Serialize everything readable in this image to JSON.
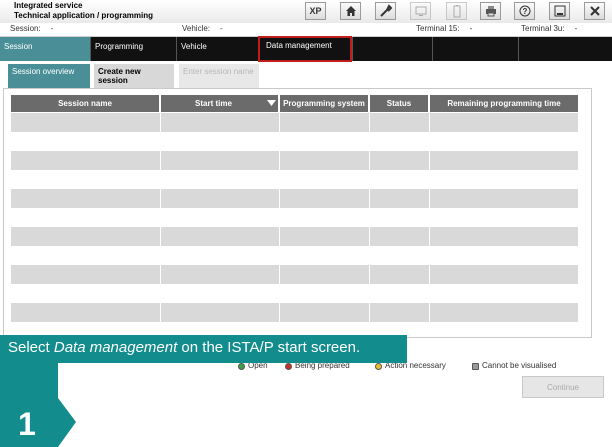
{
  "app": {
    "title_line1": "Integrated service",
    "title_line2": "Technical application / programming"
  },
  "toolbar": {
    "xp_label": "XP"
  },
  "infobar": {
    "session_label": "Session:",
    "session_value": "-",
    "vehicle_label": "Vehicle:",
    "vehicle_value": "-",
    "terminal15_label": "Terminal 15:",
    "terminal15_value": "-",
    "terminal30_label": "Terminal 3u:",
    "terminal30_value": "-"
  },
  "nav": {
    "session": "Session",
    "programming": "Programming",
    "vehicle": "Vehicle",
    "data_management": "Data management"
  },
  "subtabs": {
    "overview": "Session overview",
    "create_new": "Create new session",
    "enter_name": "Enter session name"
  },
  "table": {
    "headers": [
      "Session name",
      "Start time",
      "Programming system",
      "Status",
      "Remaining programming time"
    ]
  },
  "caption": {
    "before": "Select ",
    "italic": "Data management",
    "after": " on the ISTA/P start screen."
  },
  "step": {
    "number": "1"
  },
  "legend": {
    "open": "Open",
    "being_prepared": "Being prepared",
    "action_necessary": "Action necessary",
    "cannot_visualise": "Cannot be visualised",
    "colors": {
      "open": "#3aa04a",
      "being_prepared": "#c9322b",
      "action_necessary": "#e8c02a",
      "cannot_visualise": "#9a9a9a"
    }
  },
  "buttons": {
    "continue": "Continue"
  },
  "colors": {
    "accent": "#4a8f97",
    "caption_bg": "#128c8c",
    "highlight": "#c21d1d"
  }
}
